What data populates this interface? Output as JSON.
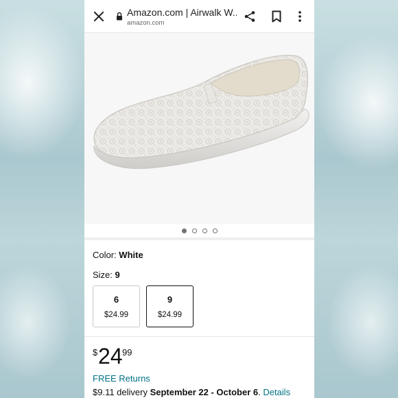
{
  "topbar": {
    "title": "Amazon.com | Airwalk W...",
    "url": "amazon.com",
    "icons": [
      "close-icon",
      "lock-icon",
      "share-icon",
      "bookmark-icon",
      "more-vert-icon"
    ]
  },
  "carousel": {
    "image": "white lace slip-on shoe",
    "total_images": 4,
    "active_index": 0
  },
  "color": {
    "label": "Color: ",
    "value": "White"
  },
  "size": {
    "label": "Size: ",
    "value": "9",
    "options": [
      {
        "size": "6",
        "price": "$24.99",
        "selected": false
      },
      {
        "size": "9",
        "price": "$24.99",
        "selected": true
      }
    ]
  },
  "price": {
    "currency": "$",
    "whole": "24",
    "fraction": "99"
  },
  "returns": "FREE Returns",
  "delivery": {
    "prefix": "$9.11 delivery ",
    "dates": "September 22 - October 6",
    "separator": ". ",
    "link": "Details"
  },
  "colors": {
    "link": "#007185",
    "text": "#0f1111"
  }
}
